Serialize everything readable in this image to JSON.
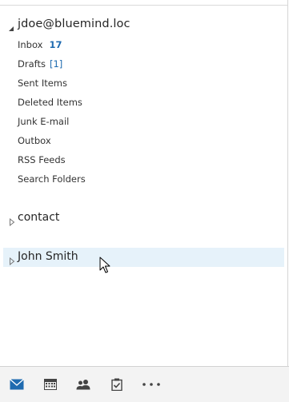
{
  "account": {
    "name": "jdoe@bluemind.loc",
    "folders": [
      {
        "label": "Inbox",
        "count": "17"
      },
      {
        "label": "Drafts",
        "count": "[1]"
      },
      {
        "label": "Sent Items",
        "count": ""
      },
      {
        "label": "Deleted Items",
        "count": ""
      },
      {
        "label": "Junk E-mail",
        "count": ""
      },
      {
        "label": "Outbox",
        "count": ""
      },
      {
        "label": "RSS Feeds",
        "count": ""
      },
      {
        "label": "Search Folders",
        "count": ""
      }
    ]
  },
  "groups": [
    {
      "label": "contact"
    },
    {
      "label": "John Smith"
    }
  ],
  "nav": {
    "items": [
      {
        "icon": "mail-icon",
        "selected": true
      },
      {
        "icon": "calendar-icon",
        "selected": false
      },
      {
        "icon": "people-icon",
        "selected": false
      },
      {
        "icon": "tasks-icon",
        "selected": false
      },
      {
        "icon": "more-icon",
        "selected": false
      }
    ]
  },
  "colors": {
    "accent": "#1f6bb0",
    "hover_row": "#e6f2fa",
    "nav_bg": "#f3f3f3"
  }
}
